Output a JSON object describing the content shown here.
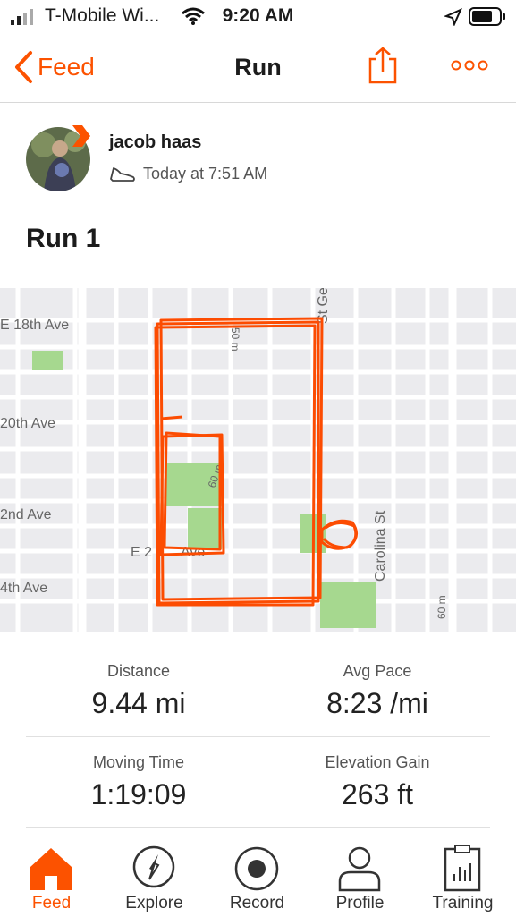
{
  "status_bar": {
    "carrier": "T-Mobile Wi...",
    "time": "9:20 AM"
  },
  "nav": {
    "back_label": "Feed",
    "title": "Run"
  },
  "activity": {
    "athlete_name": "jacob haas",
    "timestamp": "Today at 7:51 AM",
    "title": "Run 1"
  },
  "map": {
    "streets": [
      "E 18th Ave",
      "20th Ave",
      "2nd Ave",
      "E 2",
      "Ave",
      "4th Ave",
      "St Ge",
      "Carolina St"
    ],
    "contours": [
      "50 m",
      "60 m",
      "60 m"
    ]
  },
  "stats": {
    "distance": {
      "label": "Distance",
      "value": "9.44 mi"
    },
    "avg_pace": {
      "label": "Avg Pace",
      "value": "8:23 /mi"
    },
    "moving_time": {
      "label": "Moving Time",
      "value": "1:19:09"
    },
    "elevation_gain": {
      "label": "Elevation Gain",
      "value": "263 ft"
    }
  },
  "tabs": [
    {
      "label": "Feed",
      "icon": "home-icon",
      "active": true
    },
    {
      "label": "Explore",
      "icon": "compass-icon",
      "active": false
    },
    {
      "label": "Record",
      "icon": "record-icon",
      "active": false
    },
    {
      "label": "Profile",
      "icon": "profile-icon",
      "active": false
    },
    {
      "label": "Training",
      "icon": "training-icon",
      "active": false
    }
  ],
  "colors": {
    "accent": "#fc5200",
    "route": "#fc4c02",
    "park": "#a6d88f"
  }
}
